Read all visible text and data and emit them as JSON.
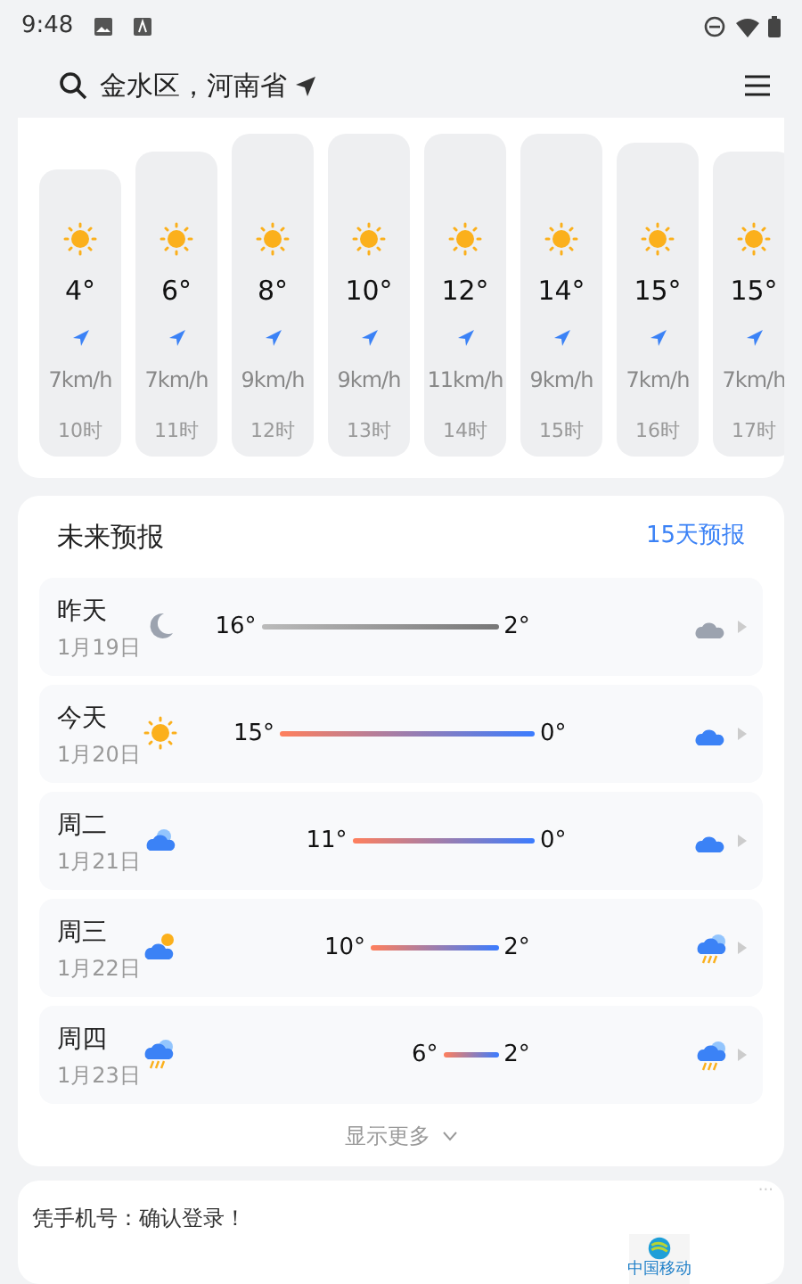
{
  "status_bar": {
    "time": "9:48"
  },
  "header": {
    "location": "金水区，河南省"
  },
  "hourly": [
    {
      "temp": "4°",
      "wind": "7km/h",
      "hour": "10时"
    },
    {
      "temp": "6°",
      "wind": "7km/h",
      "hour": "11时"
    },
    {
      "temp": "8°",
      "wind": "9km/h",
      "hour": "12时"
    },
    {
      "temp": "10°",
      "wind": "9km/h",
      "hour": "13时"
    },
    {
      "temp": "12°",
      "wind": "11km/h",
      "hour": "14时"
    },
    {
      "temp": "14°",
      "wind": "9km/h",
      "hour": "15时"
    },
    {
      "temp": "15°",
      "wind": "7km/h",
      "hour": "16时"
    },
    {
      "temp": "15°",
      "wind": "7km/h",
      "hour": "17时"
    }
  ],
  "forecast": {
    "title": "未来预报",
    "link": "15天预报",
    "more": "显示更多",
    "days": [
      {
        "day": "昨天",
        "date": "1月19日",
        "past": true,
        "day_icon": {
          "kind": "moon"
        },
        "high": "16°",
        "low": "2°",
        "night_icon": {
          "kind": "cloudnight"
        }
      },
      {
        "day": "今天",
        "date": "1月20日",
        "past": false,
        "day_icon": {
          "kind": "sun"
        },
        "high": "15°",
        "low": "0°",
        "night_icon": {
          "kind": "cloudnight"
        }
      },
      {
        "day": "周二",
        "date": "1月21日",
        "past": false,
        "day_icon": {
          "kind": "cloud"
        },
        "high": "11°",
        "low": "0°",
        "night_icon": {
          "kind": "cloudnight"
        }
      },
      {
        "day": "周三",
        "date": "1月22日",
        "past": false,
        "day_icon": {
          "kind": "suncloud"
        },
        "high": "10°",
        "low": "2°",
        "night_icon": {
          "kind": "storm"
        }
      },
      {
        "day": "周四",
        "date": "1月23日",
        "past": false,
        "day_icon": {
          "kind": "storm"
        },
        "high": "6°",
        "low": "2°",
        "night_icon": {
          "kind": "storm"
        }
      }
    ]
  },
  "ad": {
    "text": "凭手机号：确认登录！",
    "more": "···",
    "logo_text": "中国移动"
  }
}
